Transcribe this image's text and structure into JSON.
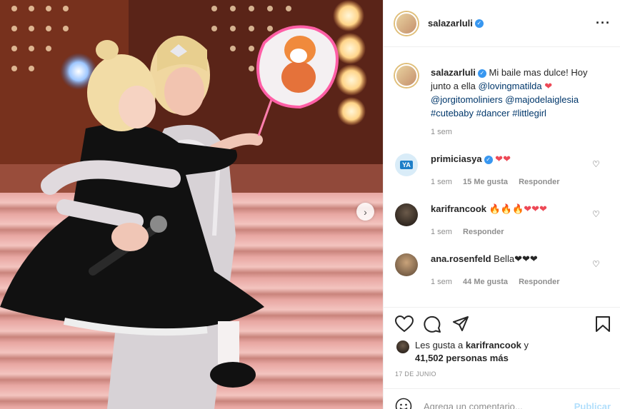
{
  "post": {
    "username": "salazarluli",
    "verified_icon": "verified-badge-icon",
    "more_icon": "more-options-icon"
  },
  "caption": {
    "username": "salazarluli",
    "text_before": "Mi baile mas dulce! Hoy junto a ella ",
    "mention1": "@lovingmatilda",
    "heart": "❤",
    "mention2": "@jorgitomoliniers",
    "mention3": "@majodelaiglesia",
    "tag1": "#cutebaby",
    "tag2": "#dancer",
    "tag3": "#littlegirl",
    "time": "1 sem"
  },
  "comments": [
    {
      "username": "primiciasya",
      "verified": true,
      "text": "❤❤",
      "time": "1 sem",
      "likes": "15 Me gusta",
      "reply": "Responder",
      "avatar_text": "YA"
    },
    {
      "username": "karifrancook",
      "verified": false,
      "text": "🔥🔥🔥❤❤❤",
      "time": "1 sem",
      "likes": "",
      "reply": "Responder",
      "avatar_text": ""
    },
    {
      "username": "ana.rosenfeld",
      "verified": false,
      "text": "Bella❤❤❤",
      "time": "1 sem",
      "likes": "44 Me gusta",
      "reply": "Responder",
      "avatar_text": ""
    }
  ],
  "likes": {
    "prefix": "Les gusta a ",
    "user": "karifrancook",
    "middle": " y",
    "count": "41,502 personas más"
  },
  "date": "17 DE JUNIO",
  "add_comment": {
    "placeholder": "Agrega un comentario...",
    "publish": "Publicar"
  },
  "colors": {
    "accent_link": "#00376b",
    "verified": "#3897f0",
    "heart": "#ed4956",
    "publish_disabled": "#b2dffc"
  }
}
